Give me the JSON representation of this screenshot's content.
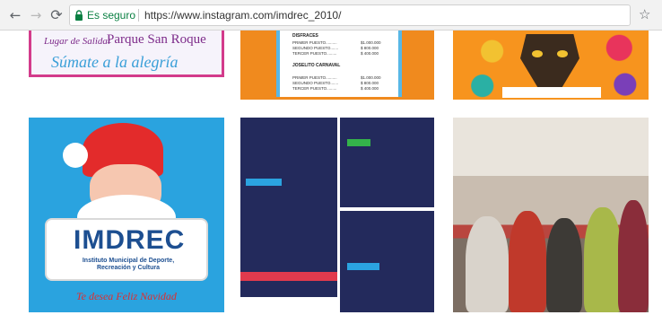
{
  "browser": {
    "back_icon": "arrow-left-icon",
    "forward_icon": "arrow-right-icon",
    "reload_icon": "reload-icon",
    "security_icon": "lock-icon",
    "security_label": "Es seguro",
    "url": "https://www.instagram.com/imdrec_2010/",
    "bookmark_icon": "star-icon",
    "security_color": "#0b8043"
  },
  "posts": {
    "p1": {
      "lugar": "Lugar de Salida:",
      "parque": "Parque San Roque",
      "sumate": "Súmate a la alegría"
    },
    "p2": {
      "heading1": "DISFRACES",
      "heading2": "JOSELITO CARNAVAL",
      "rows1": [
        {
          "label": "PRIMER PUESTO..........",
          "amount": "$1.000.000"
        },
        {
          "label": "SEGUNDO PUESTO.......",
          "amount": "$  800.000"
        },
        {
          "label": "TERCER PUESTO.........",
          "amount": "$  400.000"
        }
      ],
      "rows2": [
        {
          "label": "PRIMER PUESTO..........",
          "amount": "$1.000.000"
        },
        {
          "label": "SEGUNDO PUESTO.......",
          "amount": "$  800.000"
        },
        {
          "label": "TERCER PUESTO.........",
          "amount": "$  400.000"
        }
      ]
    },
    "p4": {
      "brand": "IMDREC",
      "institute": "Instituto Municipal de Deporte, Recreación y Cultura",
      "greeting": "Te desea Feliz Navidad"
    }
  }
}
